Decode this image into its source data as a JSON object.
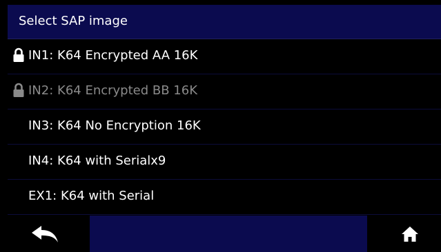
{
  "header": {
    "title": "Select SAP image"
  },
  "list": {
    "items": [
      {
        "label": "IN1: K64 Encrypted AA 16K",
        "icon": "lock-icon",
        "disabled": false
      },
      {
        "label": "IN2: K64 Encrypted BB 16K",
        "icon": "lock-icon",
        "disabled": true
      },
      {
        "label": "IN3: K64 No Encryption 16K",
        "icon": null,
        "disabled": false
      },
      {
        "label": "IN4: K64 with Serialx9",
        "icon": null,
        "disabled": false
      },
      {
        "label": "EX1: K64 with Serial",
        "icon": null,
        "disabled": false
      }
    ]
  },
  "toolbar": {
    "back_icon": "back-arrow-icon",
    "home_icon": "home-icon"
  },
  "colors": {
    "header_bg": "#0b0b4f",
    "toolbar_strip": "#0b0b4f",
    "text": "#ffffff",
    "disabled_text": "#8a8a8a",
    "background": "#000000"
  }
}
